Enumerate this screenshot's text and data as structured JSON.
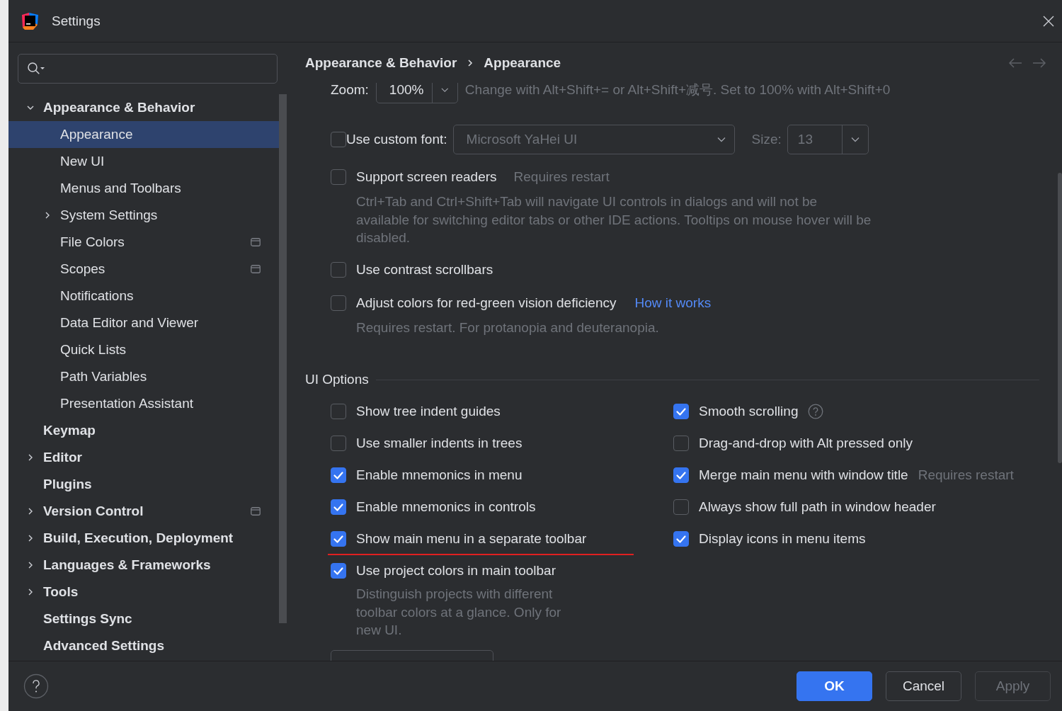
{
  "window": {
    "title": "Settings"
  },
  "sidebar": {
    "items": [
      {
        "label": "Appearance & Behavior",
        "kind": "group",
        "expanded": true,
        "selected": false,
        "project_icon": false,
        "children": [
          {
            "label": "Appearance",
            "kind": "leaf",
            "selected": true,
            "project_icon": false
          },
          {
            "label": "New UI",
            "kind": "leaf",
            "selected": false,
            "project_icon": false
          },
          {
            "label": "Menus and Toolbars",
            "kind": "leaf",
            "selected": false,
            "project_icon": false
          },
          {
            "label": "System Settings",
            "kind": "group",
            "expanded": false,
            "selected": false,
            "project_icon": false
          },
          {
            "label": "File Colors",
            "kind": "leaf",
            "selected": false,
            "project_icon": true
          },
          {
            "label": "Scopes",
            "kind": "leaf",
            "selected": false,
            "project_icon": true
          },
          {
            "label": "Notifications",
            "kind": "leaf",
            "selected": false,
            "project_icon": false
          },
          {
            "label": "Data Editor and Viewer",
            "kind": "leaf",
            "selected": false,
            "project_icon": false
          },
          {
            "label": "Quick Lists",
            "kind": "leaf",
            "selected": false,
            "project_icon": false
          },
          {
            "label": "Path Variables",
            "kind": "leaf",
            "selected": false,
            "project_icon": false
          },
          {
            "label": "Presentation Assistant",
            "kind": "leaf",
            "selected": false,
            "project_icon": false
          }
        ]
      },
      {
        "label": "Keymap",
        "kind": "leaf",
        "selected": false,
        "project_icon": false
      },
      {
        "label": "Editor",
        "kind": "group",
        "expanded": false,
        "selected": false,
        "project_icon": false
      },
      {
        "label": "Plugins",
        "kind": "leaf",
        "selected": false,
        "project_icon": false
      },
      {
        "label": "Version Control",
        "kind": "group",
        "expanded": false,
        "selected": false,
        "project_icon": true
      },
      {
        "label": "Build, Execution, Deployment",
        "kind": "group",
        "expanded": false,
        "selected": false,
        "project_icon": false
      },
      {
        "label": "Languages & Frameworks",
        "kind": "group",
        "expanded": false,
        "selected": false,
        "project_icon": false
      },
      {
        "label": "Tools",
        "kind": "group",
        "expanded": false,
        "selected": false,
        "project_icon": false
      },
      {
        "label": "Settings Sync",
        "kind": "leaf",
        "selected": false,
        "project_icon": false
      },
      {
        "label": "Advanced Settings",
        "kind": "leaf",
        "selected": false,
        "project_icon": false
      }
    ]
  },
  "breadcrumb": [
    "Appearance & Behavior",
    "Appearance"
  ],
  "zoom": {
    "label": "Zoom:",
    "value": "100%",
    "hint": "Change with Alt+Shift+= or Alt+Shift+减号. Set to 100% with Alt+Shift+0"
  },
  "custom_font": {
    "label": "Use custom font:",
    "checked": false,
    "font": "Microsoft YaHei UI",
    "size_label": "Size:",
    "size": "13"
  },
  "options": [
    {
      "label": "Support screen readers",
      "checked": false,
      "note": "Requires restart",
      "description": "Ctrl+Tab and Ctrl+Shift+Tab will navigate UI controls in dialogs and will not be available for switching editor tabs or other IDE actions. Tooltips on mouse hover will be disabled."
    },
    {
      "label": "Use contrast scrollbars",
      "checked": false
    },
    {
      "label": "Adjust colors for red-green vision deficiency",
      "checked": false,
      "link": "How it works",
      "description": "Requires restart. For protanopia and deuteranopia."
    }
  ],
  "ui_options": {
    "title": "UI Options",
    "left": [
      {
        "label": "Show tree indent guides",
        "checked": false,
        "underlined": false
      },
      {
        "label": "Use smaller indents in trees",
        "checked": false,
        "underlined": false
      },
      {
        "label": "Enable mnemonics in menu",
        "checked": true,
        "underlined": false
      },
      {
        "label": "Enable mnemonics in controls",
        "checked": true,
        "underlined": false
      },
      {
        "label": "Show main menu in a separate toolbar",
        "checked": true,
        "underlined": true
      },
      {
        "label": "Use project colors in main toolbar",
        "checked": true,
        "underlined": false,
        "description": "Distinguish projects with different toolbar colors at a glance. Only for new UI."
      }
    ],
    "right": [
      {
        "label": "Smooth scrolling",
        "checked": true,
        "underlined": false,
        "help": true
      },
      {
        "label": "Drag-and-drop with Alt pressed only",
        "checked": false,
        "underlined": false
      },
      {
        "label": "Merge main menu with window title",
        "checked": true,
        "underlined": false,
        "note": "Requires restart"
      },
      {
        "label": "Always show full path in window header",
        "checked": false,
        "underlined": false
      },
      {
        "label": "Display icons in menu items",
        "checked": true,
        "underlined": false
      }
    ]
  },
  "buttons": [
    {
      "label": "OK",
      "kind": "primary"
    },
    {
      "label": "Cancel",
      "kind": "secondary"
    },
    {
      "label": "Apply",
      "kind": "disabled"
    }
  ]
}
